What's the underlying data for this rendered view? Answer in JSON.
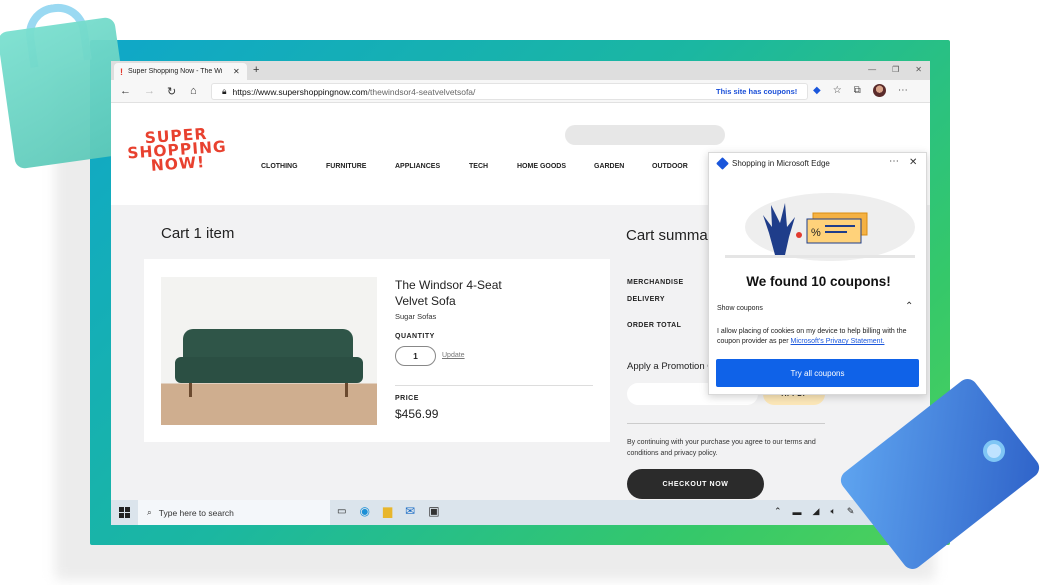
{
  "browser": {
    "tab_title": "Super Shopping Now - The Wi",
    "new_tab_glyph": "+",
    "url_domain": "https://www.supershoppingnow.com",
    "url_path": "/thewindsor4-seatvelvetsofa/",
    "coupon_notice": "This site has coupons!"
  },
  "site": {
    "logo_lines": [
      "SUPER",
      "SHOPPING",
      "NOW!"
    ],
    "menu": [
      "CLOTHING",
      "FURNITURE",
      "APPLIANCES",
      "TECH",
      "HOME GOODS",
      "GARDEN",
      "OUTDOOR"
    ]
  },
  "cart": {
    "title": "Cart",
    "item_count": "1 item",
    "product_name_line1": "The Windsor 4-Seat",
    "product_name_line2": "Velvet Sofa",
    "brand": "Sugar Sofas",
    "quantity_label": "QUANTITY",
    "quantity_value": "1",
    "update_label": "Update",
    "price_label": "PRICE",
    "price_value": "$456.99"
  },
  "summary": {
    "title": "Cart summa",
    "merchandise_label": "MERCHANDISE",
    "delivery_label": "DELIVERY",
    "order_total_label": "ORDER TOTAL",
    "promo_title": "Apply a Promotion Code",
    "apply_label": "APPLY",
    "terms": "By continuing with your purchase you agree to our terms and conditions and privacy policy.",
    "checkout_label": "CHECKOUT NOW"
  },
  "coupon_panel": {
    "header": "Shopping in Microsoft Edge",
    "found_text": "We found 10 coupons!",
    "show_coupons_label": "Show coupons",
    "consent_text": "I allow placing of cookies on my device to help billing with the coupon provider as per ",
    "privacy_link": "Microsoft's Privacy Statement.",
    "try_label": "Try all coupons",
    "percent_glyph": "%"
  },
  "taskbar": {
    "search_placeholder": "Type here to search"
  },
  "colors": {
    "frame_gradient_start": "#0fa7c9",
    "frame_gradient_end": "#4fd15a",
    "logo_red": "#e8412f",
    "edge_blue": "#0f62e8",
    "apply_yellow": "#fce7b8",
    "checkout_dark": "#2b2b2b"
  },
  "icons": [
    "back-icon",
    "forward-icon",
    "refresh-icon",
    "home-icon",
    "lock-icon",
    "coupon-tag-icon",
    "favorites-icon",
    "collections-icon",
    "profile-avatar",
    "more-icon",
    "windows-start-icon",
    "search-icon",
    "task-view-icon",
    "edge-icon",
    "file-explorer-icon",
    "mail-icon",
    "store-icon"
  ]
}
